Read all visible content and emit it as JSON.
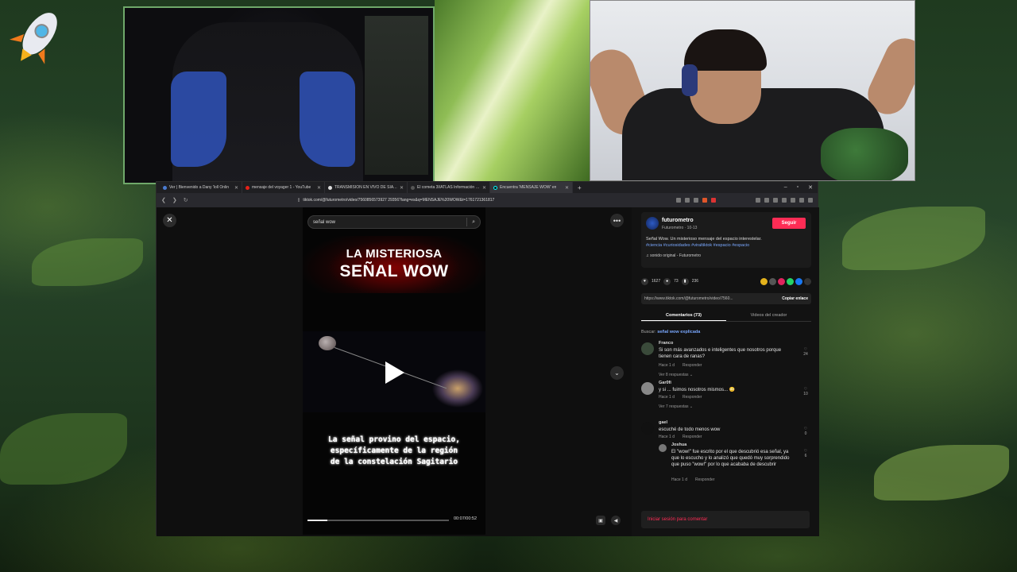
{
  "browser": {
    "tabs": [
      {
        "label": "Ver | Bienvenido a Dany 'loll Onlin",
        "color": "#4a7bd0",
        "active": false
      },
      {
        "label": "mensaje del voyager 1 - YouTube",
        "color": "#e62117",
        "active": false
      },
      {
        "label": "TRANSMISION EN VIVO DE SIATLAS",
        "color": "#dddddd",
        "active": false
      },
      {
        "label": "El cometa 3I/ATLAS Información Co",
        "color": "#2a2a2a",
        "active": false
      },
      {
        "label": "Encuentra 'MENSAJE WOW' en",
        "color": "#111111",
        "active": true
      }
    ],
    "url": "tiktok.com/@futurometro/video/7560856573927 29356?lang=es&q=MENSAJE%20WOW&t=1761721361817",
    "new_tab": "+",
    "controls": [
      "–",
      "▫",
      "✕"
    ]
  },
  "search": {
    "value": "señal wow"
  },
  "video": {
    "title_line1": "LA MISTERIOSA",
    "title_line2": "SEÑAL WOW",
    "caption": [
      "La señal provino del espacio,",
      "específicamente de la región",
      "de la constelación Sagitario"
    ],
    "time": "00:07/00:52",
    "progress": 0.14
  },
  "author": {
    "name": "futurometro",
    "sub": "Futurometro · 10-13",
    "follow": "Seguir",
    "description": "Señal Wow. Un misterioso mensaje del espacio interestelar.",
    "hashtags": "#ciencia #curiosidades #viraltiktok #espacio #espacio",
    "sound": "♫ sonido original - Futurometro"
  },
  "stats": {
    "likes": "1627",
    "comments": "73",
    "saves": "236"
  },
  "share": {
    "link": "https://www.tiktok.com/@futurometro/video/7560...",
    "copy": "Copiar enlace"
  },
  "tabs": {
    "comments": "Comentarios (73)",
    "creator_videos": "Videos del creador"
  },
  "related": {
    "prefix": "Buscar:",
    "query": "señal wow explicada"
  },
  "comments": [
    {
      "user": "Franco",
      "text": "Si son más avanzados e inteligentes que nosotros porque tienen cara de ranas?",
      "age": "Hace 1 d",
      "reply": "Responder",
      "likes": "24",
      "replies": "Ver 8 respuestas ⌄"
    },
    {
      "user": "Gar0fi",
      "text": "y si ... fuimos nosotros mismos... 😳",
      "age": "Hace 1 d",
      "reply": "Responder",
      "likes": "10",
      "replies": "Ver 7 respuestas ⌄"
    },
    {
      "user": "gael",
      "text": "escuché de todo menos wow",
      "age": "Hace 1 d",
      "reply": "Responder",
      "likes": "0",
      "replies": ""
    }
  ],
  "reply": {
    "user": "Joshua",
    "text": "El \"wow!\" fue escrito por el que descubrió esa señal, ya que lo escucho y lo analizó que quedó muy sorprendido que puso \"wow!\" por lo que acababa de descubrir",
    "age": "Hace 1 d",
    "reply": "Responder",
    "likes": "6"
  },
  "login": "Iniciar sesión para comentar"
}
